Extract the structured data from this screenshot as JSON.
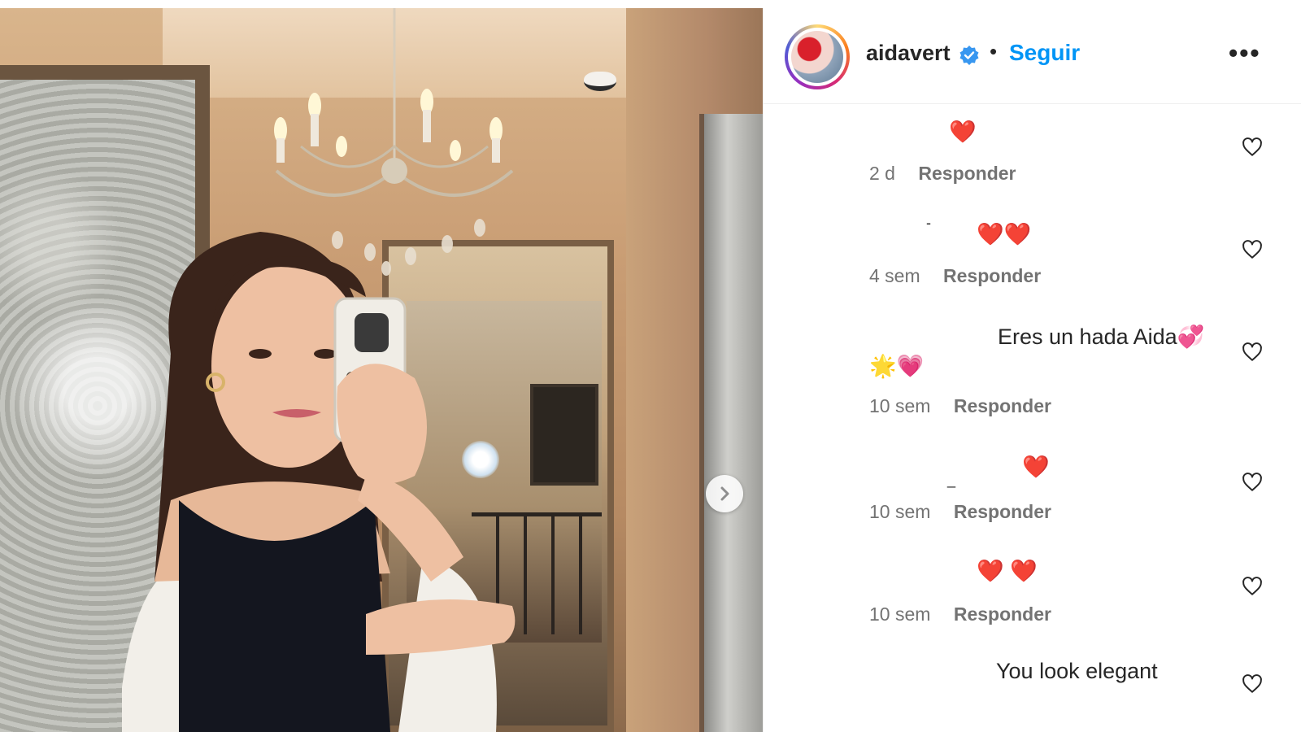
{
  "post": {
    "username": "aidavert",
    "follow_label": "Seguir",
    "separator": "•",
    "more_label": "•••",
    "next_arrow": "›"
  },
  "comments": [
    {
      "text": "❤️",
      "age": "2 d",
      "reply": "Responder"
    },
    {
      "text": "❤️❤️",
      "age": "4 sem",
      "reply": "Responder"
    },
    {
      "text": "Eres un hada Aida💞",
      "text2": "🌟💗",
      "age": "10 sem",
      "reply": "Responder"
    },
    {
      "text": "❤️",
      "age": "10 sem",
      "reply": "Responder"
    },
    {
      "text": "❤️ ❤️",
      "age": "10 sem",
      "reply": "Responder"
    },
    {
      "text": "You look elegant"
    }
  ],
  "colors": {
    "accent": "#0095f6",
    "muted": "#737373",
    "text": "#262626",
    "verified": "#3897f0"
  },
  "icons": [
    "verified-badge-icon",
    "more-options-icon",
    "heart-outline-icon",
    "chevron-right-icon"
  ]
}
